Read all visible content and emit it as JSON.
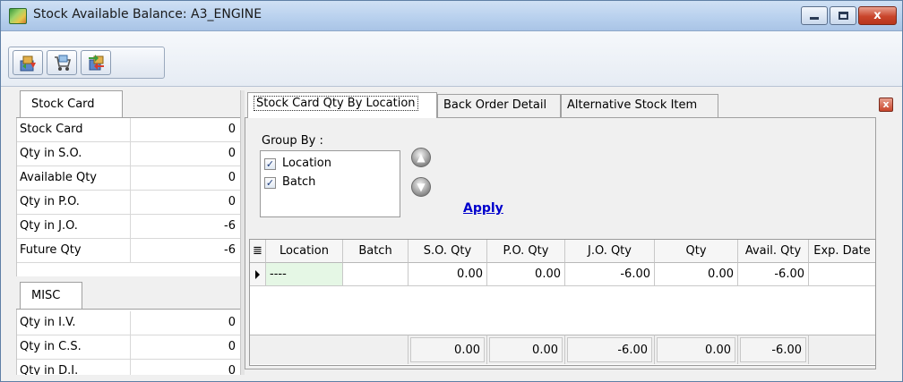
{
  "window": {
    "title": "Stock Available Balance: A3_ENGINE",
    "minimize_icon": "minimize-icon",
    "maximize_icon": "maximize-icon",
    "close_symbol": "x"
  },
  "toolbar": {
    "buttons": [
      {
        "icon": "stock-in-out-icon"
      },
      {
        "icon": "cart-icon"
      },
      {
        "icon": "transfer-icon"
      }
    ]
  },
  "left": {
    "stock_card_tab": "Stock Card",
    "stock_rows": [
      {
        "label": "Stock Card",
        "value": "0"
      },
      {
        "label": "Qty in S.O.",
        "value": "0"
      },
      {
        "label": "Available Qty",
        "value": "0"
      },
      {
        "label": "Qty in P.O.",
        "value": "0"
      },
      {
        "label": "Qty in J.O.",
        "value": "-6"
      },
      {
        "label": "Future Qty",
        "value": "-6"
      }
    ],
    "misc_tab": "MISC",
    "misc_rows": [
      {
        "label": "Qty in I.V.",
        "value": "0"
      },
      {
        "label": "Qty in C.S.",
        "value": "0"
      },
      {
        "label": "Qty in D.I.",
        "value": "0"
      }
    ]
  },
  "tabs": [
    {
      "label": "Stock Card Qty By Location",
      "active": true
    },
    {
      "label": "Back Order Detail",
      "active": false
    },
    {
      "label": "Alternative Stock Item",
      "active": false
    }
  ],
  "group_by": {
    "label": "Group By :",
    "options": [
      {
        "label": "Location",
        "checked": true
      },
      {
        "label": "Batch",
        "checked": true
      }
    ],
    "move_up_icon": "arrow-up-icon",
    "move_down_icon": "arrow-down-icon",
    "apply_label": "Apply"
  },
  "grid": {
    "columns": [
      "Location",
      "Batch",
      "S.O. Qty",
      "P.O. Qty",
      "J.O. Qty",
      "Qty",
      "Avail. Qty",
      "Exp. Date"
    ],
    "rows": [
      [
        "----",
        "",
        "0.00",
        "0.00",
        "-6.00",
        "0.00",
        "-6.00",
        ""
      ]
    ],
    "footer": [
      "",
      "",
      "0.00",
      "0.00",
      "-6.00",
      "0.00",
      "-6.00",
      ""
    ]
  },
  "colors": {
    "titlebar": "#b9d1ee",
    "selected_cell": "#e5f7e5",
    "link": "#0000cc"
  }
}
